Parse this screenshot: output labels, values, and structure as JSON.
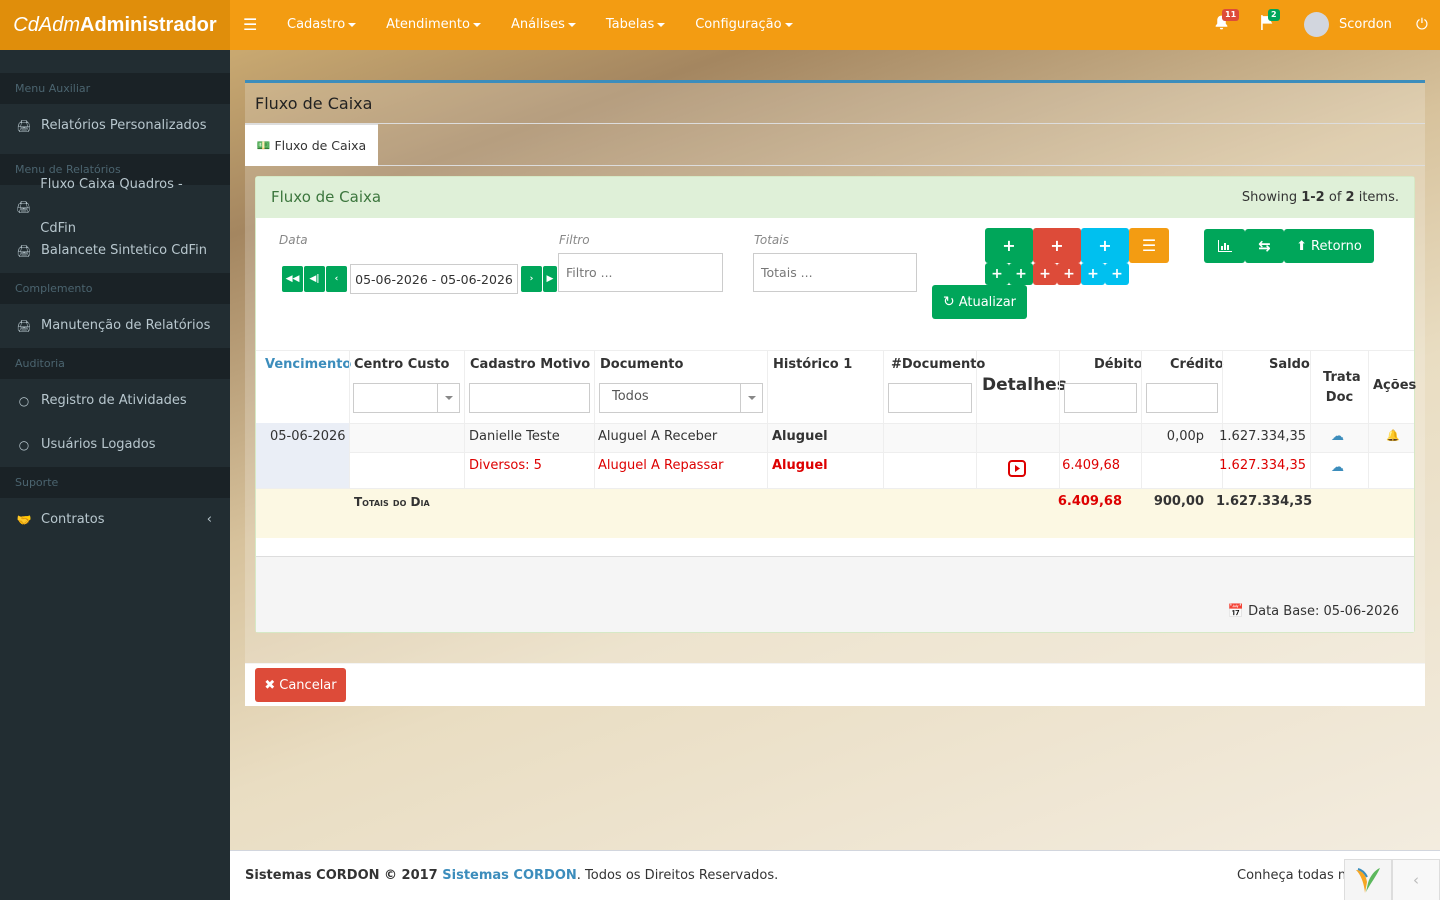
{
  "brand": {
    "light": "CdAdm",
    "bold": "Administrador"
  },
  "topnav": [
    "Cadastro",
    "Atendimento",
    "Análises",
    "Tabelas",
    "Configuração"
  ],
  "notifications": {
    "bell_count": "11",
    "flag_count": "2"
  },
  "user": {
    "name": "Scordon"
  },
  "sidebar": {
    "sections": [
      {
        "header": "Menu Auxiliar",
        "items": [
          "Relatórios Personalizados"
        ]
      },
      {
        "header": "Menu de Relatórios",
        "items": [
          "Fluxo Caixa Quadros - CdFin",
          "Balancete Sintetico CdFin"
        ]
      },
      {
        "header": "Complemento",
        "items": [
          "Manutenção de Relatórios"
        ]
      },
      {
        "header": "Auditoria",
        "items": [
          "Registro de Atividades",
          "Usuários Logados"
        ]
      },
      {
        "header": "Suporte",
        "items": [
          "Contratos"
        ]
      }
    ]
  },
  "page": {
    "title": "Fluxo de Caixa",
    "tab": "Fluxo de Caixa"
  },
  "panel": {
    "title": "Fluxo de Caixa",
    "summary_prefix": "Showing ",
    "summary_range": "1-2",
    "summary_mid": " of ",
    "summary_total": "2",
    "summary_suffix": " items."
  },
  "filters": {
    "data_label": "Data",
    "date_range": "05-06-2026 - 05-06-2026",
    "filtro_label": "Filtro",
    "filtro_placeholder": "Filtro ...",
    "totais_label": "Totais",
    "totais_placeholder": "Totais ..."
  },
  "buttons": {
    "atualizar": "Atualizar",
    "retorno": "Retorno",
    "cancelar": "Cancelar"
  },
  "table": {
    "headers": {
      "vencimento": "Vencimento",
      "centro_custo": "Centro Custo",
      "cadastro_motivo": "Cadastro Motivo",
      "documento": "Documento",
      "historico": "Histórico 1",
      "num_documento": "#Documento",
      "detalhes": "Detalhes",
      "debito": "Débito",
      "credito": "Crédito",
      "saldo": "Saldo",
      "trata_doc_1": "Trata",
      "trata_doc_2": "Doc",
      "acoes": "Ações"
    },
    "documento_filter": "Todos",
    "rows": [
      {
        "vencimento": "05-06-2026",
        "centro_custo": "",
        "cadastro_motivo": "Danielle Teste",
        "documento": "Aluguel A Receber",
        "historico": "Aluguel",
        "num_documento": "",
        "debito": "",
        "credito": "0,00p",
        "saldo": "1.627.334,35"
      },
      {
        "vencimento": "",
        "centro_custo": "",
        "cadastro_motivo": "Diversos: 5",
        "documento": "Aluguel A Repassar",
        "historico": "Aluguel",
        "num_documento": "",
        "debito": "6.409,68",
        "credito": "",
        "saldo": "1.627.334,35"
      }
    ],
    "totals": {
      "label": "Totais do Dia",
      "debito": "6.409,68",
      "credito": "900,00",
      "saldo": "1.627.334,35"
    }
  },
  "data_base": "Data Base: 05-06-2026",
  "footer": {
    "prefix": "Sistemas CORDON © 2017 ",
    "link": "Sistemas CORDON",
    "suffix": ". Todos os Direitos Reservados.",
    "right": "Conheça todas nossas"
  },
  "colors": {
    "header": "#f39c12",
    "sidebar": "#222d32",
    "success": "#00a65a",
    "danger": "#dd4b39",
    "info": "#00c0ef",
    "primary": "#3c8dbc"
  }
}
